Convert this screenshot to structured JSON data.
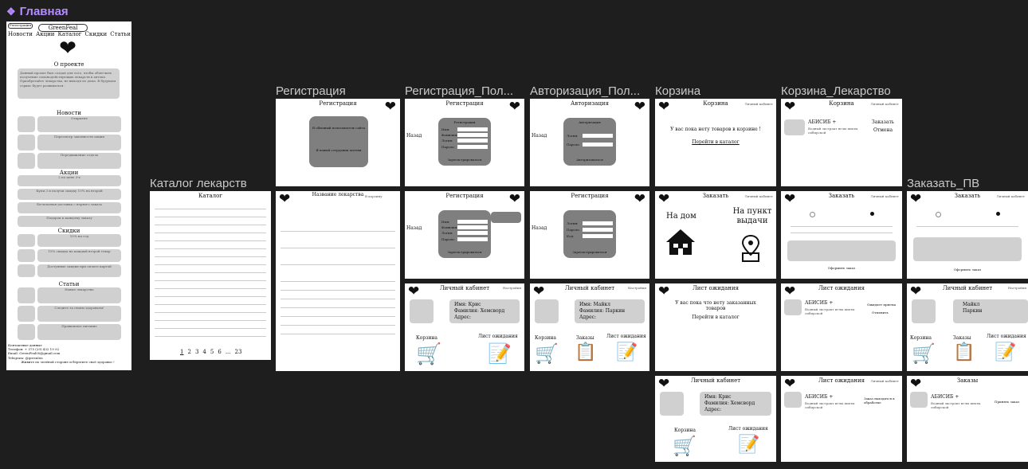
{
  "page": {
    "title": "Главная"
  },
  "colors": {
    "canvas": "#1e1e1e",
    "page_title": "#b58cff",
    "frame_label": "#c9c9c9",
    "gray_box": "#7f7f7f",
    "light_box": "#d0d0d0"
  },
  "frames": {
    "reg": "Регистрация",
    "reg_pol": "Регистрация_Пол...",
    "auth_pol": "Авторизация_Пол...",
    "cart": "Корзина",
    "cart_med": "Корзина_Лекарство",
    "catalog": "Каталог лекарств",
    "order_pv": "Заказать_ПВ"
  },
  "main": {
    "reg_btn": "Регистрация",
    "brand": "GreenFeal",
    "nav": [
      "Новости",
      "Акции",
      "Каталог",
      "Скидки",
      "Статьи"
    ],
    "about_title": "О проекте",
    "about_text": "Данный проект был создан для того, чтобы облегчить получение сильнодействующих лекарств в аптеке. Приобретайте лекарства, не выходя из дома. В будущем сервис будет развиваться.",
    "news_title": "Новости",
    "news": [
      "Открытие",
      "Пересмотр законности акции",
      "Передвижение отдела"
    ],
    "promo_title": "Акции",
    "promos": [
      "2 по цене 3-х",
      "Купи 3 и получи скидку 10% на второй",
      "Бесплатная доставка с первого заказа",
      "Подарок к каждому заказу"
    ],
    "sales_title": "Скидки",
    "sales": [
      "10% на год",
      "15% скидка на каждый второй товар",
      "Доступные скидки при оплате картой"
    ],
    "articles_title": "Статьи",
    "articles": [
      "Новые лекарства",
      "Следите за своим здоровьем!",
      "Правильное питание"
    ],
    "contacts": "Контактные данные",
    "phone": "Телефон: + 375 (29) 432 19 92",
    "email": "Email: GreenFeal00@gmail.com",
    "telegram": "Telegram: @greenlen",
    "slogan": "Живите по зелёной стороне и берегите своё здоровье !"
  },
  "reg": {
    "title": "Регистрация",
    "opt1": "Я обычный пользователь сайта",
    "opt2": "Я новый сотрудник аптеки"
  },
  "reg_pol": {
    "title": "Регистрация",
    "back": "Назад",
    "form_title": "Регистрация",
    "fields": [
      "Имя:",
      "Фамилия:",
      "Логин:",
      "Пароль:"
    ],
    "btn": "Зарегистрироваться"
  },
  "auth_pol": {
    "title": "Авторизация",
    "back": "Назад",
    "form_title": "Авторизация",
    "fields": [
      "Логин:",
      "Пароль:"
    ],
    "btn": "Авторизоваться"
  },
  "cart": {
    "title": "Корзина",
    "cabinet": "Личный кабинет",
    "empty": "У вас пока нету товаров в корзине !",
    "link": "Перейти в каталог"
  },
  "cart_med": {
    "title": "Корзина",
    "cabinet": "Личный кабинет",
    "item": "АБИСИБ +",
    "desc": "Водный экстракт иглы пихты сибирской",
    "order": "Заказать",
    "cancel": "Отмена"
  },
  "catalog": {
    "title": "Каталог",
    "pages": [
      "1",
      "2",
      "3",
      "4",
      "5",
      "6",
      "...",
      "23"
    ]
  },
  "med_name": {
    "title": "Название лекарства",
    "cart": "В корзину"
  },
  "reg2": {
    "title": "Регистрация",
    "back": "Назад",
    "fields": [
      "Имя:",
      "Фамилия:",
      "Логин:",
      "Пароль:"
    ],
    "btn": "Зарегистрироваться"
  },
  "reg3": {
    "title": "Регистрация",
    "back": "Назад",
    "fields": [
      "Логин:",
      "Пароль:",
      "Код:"
    ],
    "btn": "Зарегистрироваться"
  },
  "order": {
    "title": "Заказать",
    "cabinet": "Личный кабинет",
    "home": "На дом",
    "pickup": "На пункт выдачи"
  },
  "order2": {
    "title": "Заказать",
    "cabinet": "Личный кабинет",
    "btn": "Оформить заказ"
  },
  "order_pv": {
    "title": "Заказать",
    "cabinet": "Личный кабинет",
    "btn": "Оформить заказ"
  },
  "cab1": {
    "title": "Личный кабинет",
    "settings": "Настройки",
    "name_l": "Имя:",
    "name_v": "Крис",
    "fam_l": "Фамилия:",
    "fam_v": "Хемсворд",
    "addr_l": "Адрес:",
    "cart": "Корзина",
    "wait": "Лист ожидания"
  },
  "cab2": {
    "title": "Личный кабинет",
    "settings": "Настройки",
    "name_l": "Имя:",
    "name_v": "Майкл",
    "fam_l": "Фамилия:",
    "fam_v": "Паркин",
    "addr_l": "Адрес:",
    "cart": "Корзина",
    "orders": "Заказы",
    "wait": "Лист ожидания"
  },
  "wait1": {
    "title": "Лист ожидания",
    "empty": "У вас пока что нету заказанных товаров",
    "link": "Перейти в каталог"
  },
  "wait2": {
    "title": "Лист ожидания",
    "item": "АБИСИБ +",
    "desc": "Водный экстракт иглы пихты сибирской",
    "status": "Ожидает приема",
    "cancel": "Отменить"
  },
  "cab3": {
    "title": "Личный кабинет",
    "settings": "Настройки",
    "name_v": "Майкл",
    "fam_v": "Паркин",
    "cart": "Корзина",
    "orders": "Заказы",
    "wait": "Лист ожидания"
  },
  "cab4": {
    "title": "Личный кабинет",
    "name_l": "Имя:",
    "name_v": "Крис",
    "fam_l": "Фамилия:",
    "fam_v": "Хемсворд",
    "addr_l": "Адрес:",
    "cart": "Корзина",
    "wait": "Лист ожидания"
  },
  "wait3": {
    "title": "Лист ожидания",
    "cabinet": "Личный кабинет",
    "item": "АБИСИБ +",
    "desc": "Водный экстракт иглы пихты сибирской",
    "status": "Заказ находится в обработке"
  },
  "orders": {
    "title": "Заказы",
    "item": "АБИСИБ +",
    "desc": "Водный экстракт иглы пихты сибирской",
    "accept": "Принять заказ"
  }
}
